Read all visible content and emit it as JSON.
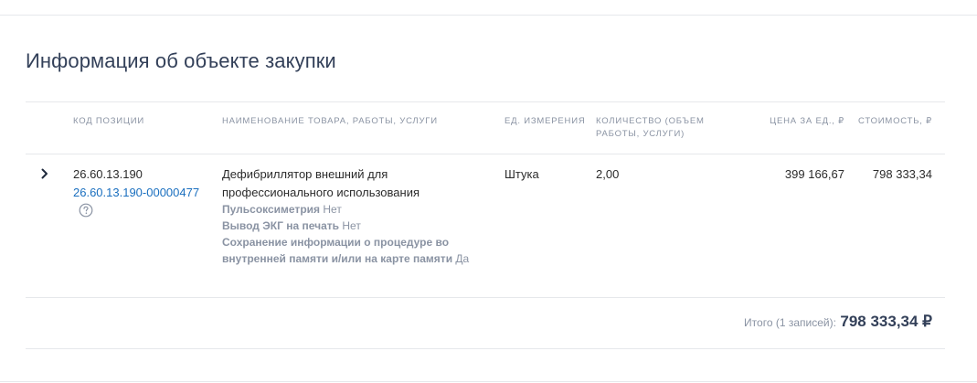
{
  "section": {
    "title": "Информация об объекте закупки"
  },
  "table": {
    "headers": {
      "code": "КОД ПОЗИЦИИ",
      "name": "НАИМЕНОВАНИЕ ТОВАРА, РАБОТЫ, УСЛУГИ",
      "unit": "ЕД. ИЗМЕРЕНИЯ",
      "qty": "КОЛИЧЕСТВО (ОБЪЕМ РАБОТЫ, УСЛУГИ)",
      "price": "ЦЕНА ЗА ЕД., ₽",
      "cost": "СТОИМОСТЬ, ₽"
    },
    "rows": [
      {
        "code": "26.60.13.190",
        "code_link": "26.60.13.190-00000477",
        "name": "Дефибриллятор внешний для профессионального использования",
        "properties": [
          {
            "key": "Пульсоксиметрия",
            "value": "Нет"
          },
          {
            "key": "Вывод ЭКГ на печать",
            "value": "Нет"
          },
          {
            "key": "Сохранение информации о процедуре во внутренней памяти и/или на карте памяти",
            "value": "Да"
          }
        ],
        "unit": "Штука",
        "qty": "2,00",
        "price": "399 166,67",
        "cost": "798 333,34"
      }
    ]
  },
  "totals": {
    "label": "Итого (1 записей):",
    "value": "798 333,34 ₽"
  },
  "icons": {
    "expand": "chevron-right-icon",
    "help": "question-circle-icon"
  }
}
